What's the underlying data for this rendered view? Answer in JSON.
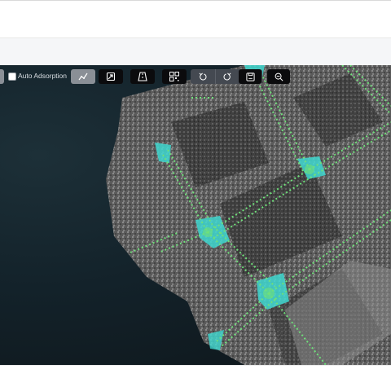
{
  "toolbar": {
    "auto_adsorption_label": "Auto Adsorption",
    "auto_adsorption_checked": false,
    "tools": [
      {
        "icon": "polyline-draw-icon",
        "active": true
      },
      {
        "icon": "arrow-edit-icon",
        "active": false
      },
      {
        "icon": "road-icon",
        "active": false
      },
      {
        "icon": "qr-grid-icon",
        "active": false
      },
      {
        "icon": "undo-icon",
        "active": false
      },
      {
        "icon": "redo-icon",
        "active": false
      },
      {
        "icon": "save-icon",
        "active": false
      },
      {
        "icon": "zoom-out-icon",
        "active": false
      }
    ]
  },
  "colors": {
    "road_marker": "#6fe07a",
    "surface_fill": "#3fd8d0",
    "viewer_background": "#13222a",
    "point_cloud": "#9a9a9a"
  }
}
